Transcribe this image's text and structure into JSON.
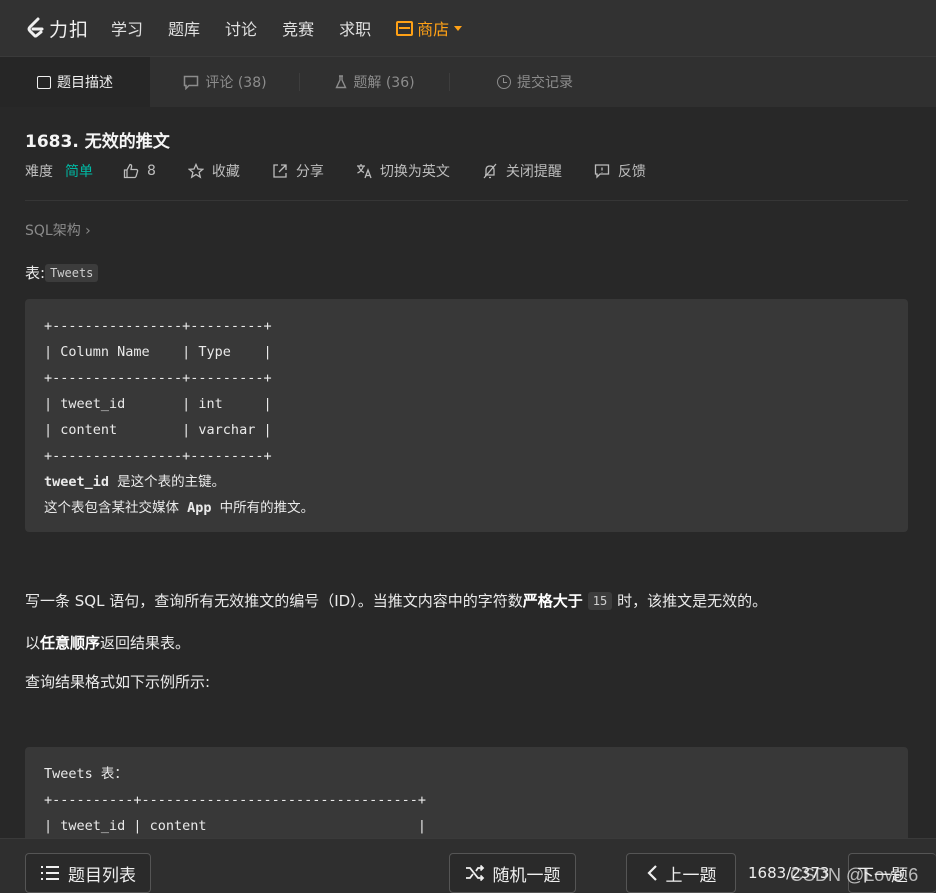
{
  "nav": {
    "logo_text": "力扣",
    "items": [
      "学习",
      "题库",
      "讨论",
      "竞赛",
      "求职"
    ],
    "store": "商店",
    "accent": "#ffa116"
  },
  "tabs": [
    {
      "label": "题目描述",
      "active": true
    },
    {
      "label": "评论 (38)",
      "active": false
    },
    {
      "label": "题解 (36)",
      "active": false
    },
    {
      "label": "提交记录",
      "active": false
    }
  ],
  "problem": {
    "title": "1683. 无效的推文",
    "difficulty_label": "难度",
    "difficulty": "简单",
    "difficulty_color": "#00b8a3",
    "likes": "8",
    "favorite": "收藏",
    "share": "分享",
    "switch_lang": "切换为英文",
    "close_reminder": "关闭提醒",
    "feedback": "反馈",
    "tag": "SQL架构 ›",
    "table_label": "表:",
    "table_name": "Tweets",
    "schema_block": "+----------------+---------+\n| Column Name    | Type    |\n+----------------+---------+\n| tweet_id       | int     |\n| content        | varchar |\n+----------------+---------+",
    "schema_note1_code": "tweet_id",
    "schema_note1": " 是这个表的主键。",
    "schema_note2_a": "这个表包含某社交媒体 ",
    "schema_note2_code": "App",
    "schema_note2_b": " 中所有的推文。",
    "desc_a": "写一条 SQL 语句，查询所有无效推文的编号（ID）。当推文内容中的字符数",
    "desc_bold": "严格大于",
    "desc_code": "15",
    "desc_b": "时，该推文是无效的。",
    "order_a": "以",
    "order_bold": "任意顺序",
    "order_b": "返回结果表。",
    "format": "查询结果格式如下示例所示:",
    "example_block": "Tweets 表：\n+----------+----------------------------------+\n| tweet_id | content                          |"
  },
  "bottom": {
    "list": "题目列表",
    "random": "随机一题",
    "prev": "上一题",
    "counter": "1683/2373",
    "next": "下一题",
    "watermark": "CSDN @Love 6"
  }
}
